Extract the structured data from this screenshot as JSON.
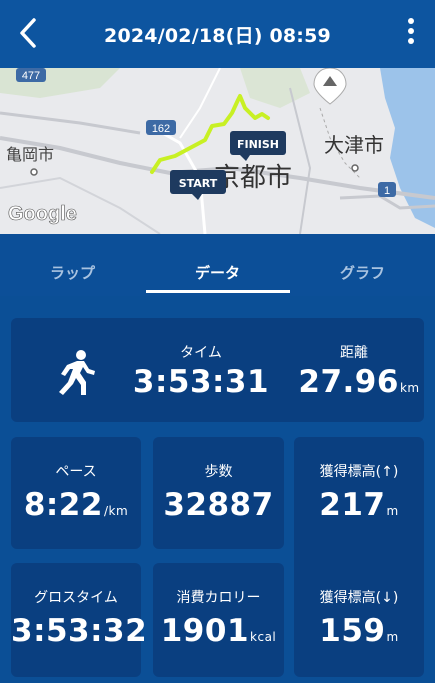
{
  "header": {
    "title": "2024/02/18(日) 08:59",
    "back_icon": "chevron-left-icon",
    "menu_icon": "more-vertical-icon"
  },
  "map": {
    "labels": {
      "road_477": "477",
      "road_162": "162",
      "road_1": "1",
      "kameoka": "亀岡市",
      "kyoto": "京都市",
      "otsu": "大津市",
      "google": "Google",
      "finish": "FINISH",
      "start": "START"
    },
    "route_color": "#c8f024"
  },
  "tabs": [
    {
      "label": "ラップ",
      "active": false
    },
    {
      "label": "データ",
      "active": true
    },
    {
      "label": "グラフ",
      "active": false
    }
  ],
  "stats": {
    "activity_icon": "runner-icon",
    "time": {
      "label": "タイム",
      "value": "3:53:31"
    },
    "distance": {
      "label": "距離",
      "value": "27.96",
      "unit": "km"
    },
    "pace": {
      "label": "ペース",
      "value": "8:22",
      "unit": "/km"
    },
    "steps": {
      "label": "歩数",
      "value": "32887"
    },
    "elev_gain": {
      "label": "獲得標高(↑)",
      "value": "217",
      "unit": "m"
    },
    "gross_time": {
      "label": "グロスタイム",
      "value": "3:53:32"
    },
    "calories": {
      "label": "消費カロリー",
      "value": "1901",
      "unit": "kcal"
    },
    "elev_loss": {
      "label": "獲得標高(↓)",
      "value": "159",
      "unit": "m"
    }
  }
}
